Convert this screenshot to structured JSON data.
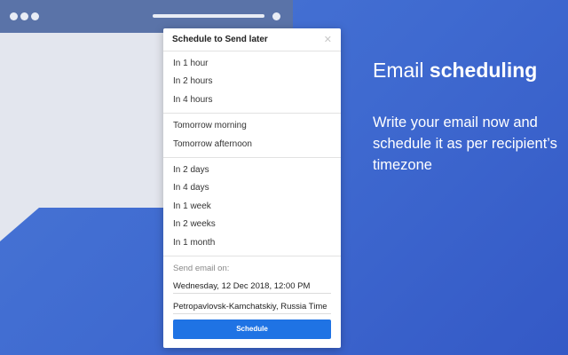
{
  "popup": {
    "title": "Schedule to Send later",
    "close_icon": "close-icon",
    "groups": [
      [
        "In 1 hour",
        "In 2 hours",
        "In 4 hours"
      ],
      [
        "Tomorrow morning",
        "Tomorrow afternoon"
      ],
      [
        "In 2 days",
        "In 4 days",
        "In 1 week",
        "In 2 weeks",
        "In 1 month"
      ]
    ],
    "send_label": "Send email on:",
    "datetime": "Wednesday, 12 Dec 2018, 12:00 PM",
    "timezone": "Petropavlovsk-Kamchatskiy, Russia Time",
    "schedule_label": "Schedule"
  },
  "promo": {
    "headline_regular": "Email ",
    "headline_bold": "scheduling",
    "subtext": "Write your email now and schedule it as per recipient’s timezone"
  },
  "colors": {
    "background": "#3f6ad0",
    "button": "#1f73e4",
    "titlebar": "#5a73a8"
  }
}
